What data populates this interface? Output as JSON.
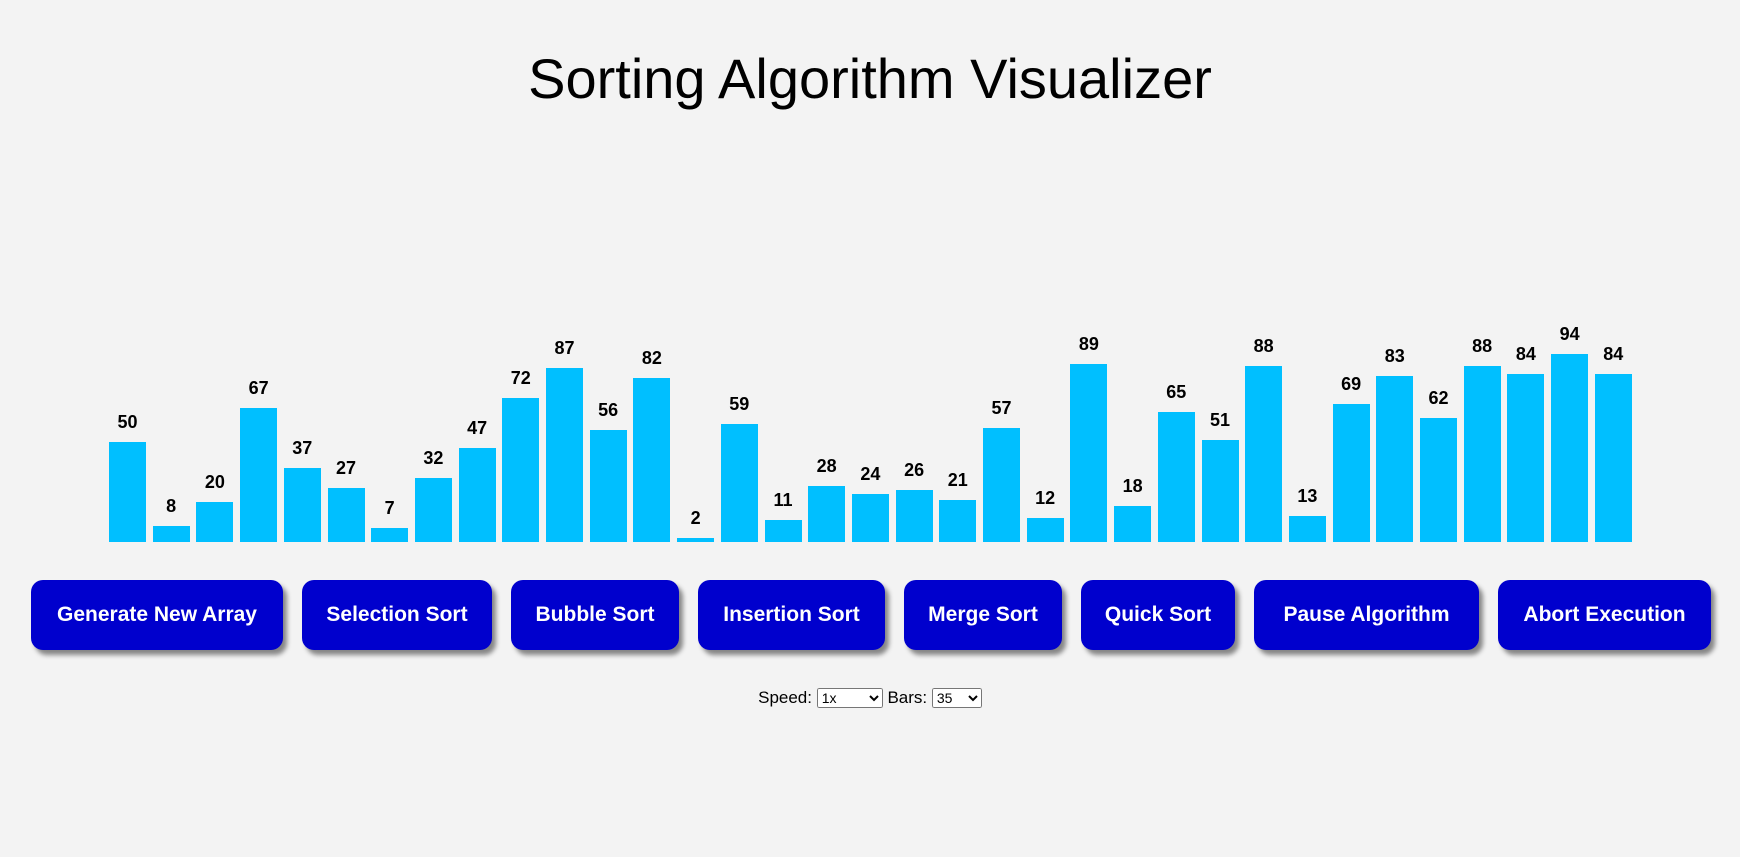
{
  "title": "Sorting Algorithm Visualizer",
  "colors": {
    "bar": "#00bfff",
    "button": "#0000cd",
    "background": "#f3f3f3"
  },
  "chart_data": {
    "type": "bar",
    "values": [
      50,
      8,
      20,
      67,
      37,
      27,
      7,
      32,
      47,
      72,
      87,
      56,
      82,
      2,
      59,
      11,
      28,
      24,
      26,
      21,
      57,
      12,
      89,
      18,
      65,
      51,
      88,
      13,
      69,
      83,
      62,
      88,
      84,
      94,
      84
    ]
  },
  "buttons": [
    "Generate New Array",
    "Selection Sort",
    "Bubble Sort",
    "Insertion Sort",
    "Merge Sort",
    "Quick Sort",
    "Pause Algorithm",
    "Abort Execution"
  ],
  "controls": {
    "speed_label": "Speed:",
    "speed_value": "1x",
    "bars_label": "Bars:",
    "bars_value": "35"
  }
}
